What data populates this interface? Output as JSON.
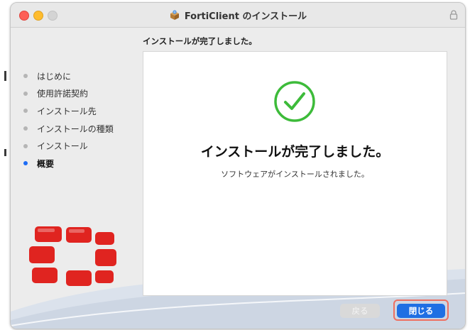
{
  "window": {
    "title": "FortiClient のインストール",
    "title_icon": "package-installer-icon",
    "lock_icon": "lock-icon"
  },
  "header": {
    "step_title": "インストールが完了しました。"
  },
  "sidebar": {
    "steps": [
      {
        "label": "はじめに",
        "active": false
      },
      {
        "label": "使用許諾契約",
        "active": false
      },
      {
        "label": "インストール先",
        "active": false
      },
      {
        "label": "インストールの種類",
        "active": false
      },
      {
        "label": "インストール",
        "active": false
      },
      {
        "label": "概要",
        "active": true
      }
    ]
  },
  "main": {
    "status_icon": "checkmark-circle-icon",
    "headline": "インストールが完了しました。",
    "subtext": "ソフトウェアがインストールされました。"
  },
  "footer": {
    "back_label": "戻る",
    "close_label": "閉じる",
    "back_enabled": false
  },
  "colors": {
    "accent": "#1f6fe3",
    "check_green": "#3dbb3a",
    "fortinet_red": "#e02420",
    "highlight": "#ee6f60"
  }
}
